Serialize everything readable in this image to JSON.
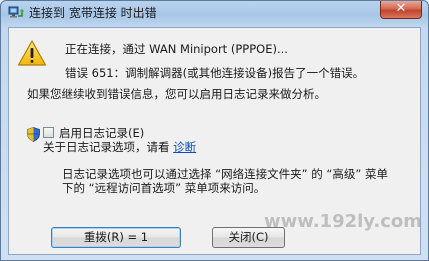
{
  "window": {
    "title": "连接到 宽带连接 时出错",
    "close_label": "✕"
  },
  "message": {
    "line1": "正在连接，通过 WAN Miniport (PPPOE)...",
    "line2": "错误 651：调制解调器(或其他连接设备)报告了一个错误。",
    "line3": "如果您继续收到错误信息，您可以启用日志记录来做分析。"
  },
  "logging": {
    "checkbox_label": "启用日志记录(E)",
    "info_prefix": "关于日志记录选项，请看",
    "diagnose_link": "诊断",
    "note_line1": "日志记录选项也可以通过选择 “网络连接文件夹” 的 “高级” 菜单",
    "note_line2": "下的 “远程访问首选项” 菜单项来访问。"
  },
  "buttons": {
    "redial": "重拨(R) = 1",
    "close": "关闭(C)"
  },
  "watermark": "www.192ly.com"
}
